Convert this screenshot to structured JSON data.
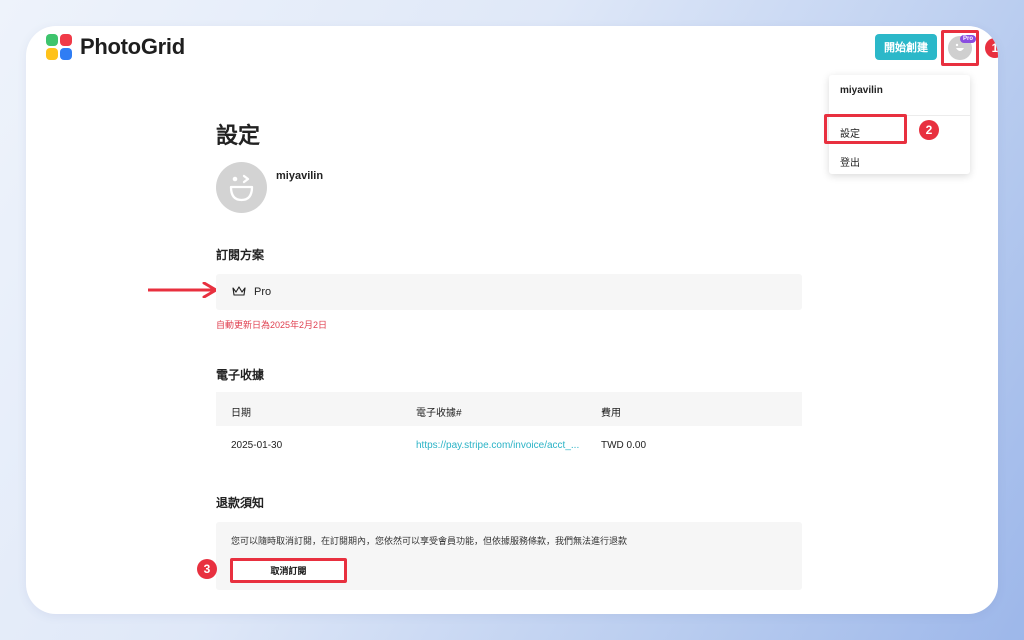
{
  "header": {
    "logo_text": "PhotoGrid",
    "create_button": "開始創建",
    "pro_badge": "Pro"
  },
  "annotations": {
    "step1": "1",
    "step2": "2",
    "step3": "3"
  },
  "dropdown": {
    "username": "miyavilin",
    "items": [
      "設定",
      "登出"
    ]
  },
  "settings": {
    "title": "設定",
    "username": "miyavilin",
    "subscription": {
      "heading": "訂閱方案",
      "plan": "Pro",
      "renewal": "自動更新日為2025年2月2日"
    },
    "receipts": {
      "heading": "電子收據",
      "columns": [
        "日期",
        "電子收據#",
        "費用"
      ],
      "rows": [
        {
          "date": "2025-01-30",
          "receipt": "https://pay.stripe.com/invoice/acct_...",
          "fee": "TWD 0.00"
        }
      ]
    },
    "refund": {
      "heading": "退款須知",
      "text": "您可以隨時取消訂閱，在訂閱期內，您依然可以享受會員功能，但依據服務條款，我們無法進行退款",
      "cancel_button": "取消訂閱"
    }
  },
  "colors": {
    "accent": "#2bb8c9",
    "highlight": "#e8303f",
    "renewal_text": "#e04050"
  }
}
